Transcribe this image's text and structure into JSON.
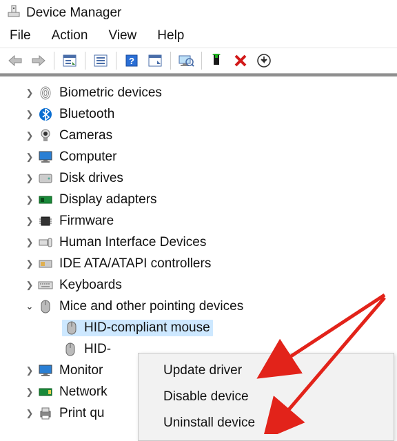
{
  "window": {
    "title": "Device Manager"
  },
  "menu": {
    "file": "File",
    "action": "Action",
    "view": "View",
    "help": "Help"
  },
  "tree": {
    "biometric": "Biometric devices",
    "bluetooth": "Bluetooth",
    "cameras": "Cameras",
    "computer": "Computer",
    "disk": "Disk drives",
    "display": "Display adapters",
    "firmware": "Firmware",
    "hid": "Human Interface Devices",
    "ide": "IDE ATA/ATAPI controllers",
    "keyboards": "Keyboards",
    "mice": "Mice and other pointing devices",
    "mice_children": {
      "c0": "HID-compliant mouse",
      "c1": "HID-"
    },
    "monitors": "Monitor",
    "network": "Network",
    "printq": "Print qu"
  },
  "context_menu": {
    "update": "Update driver",
    "disable": "Disable device",
    "uninstall": "Uninstall device"
  }
}
